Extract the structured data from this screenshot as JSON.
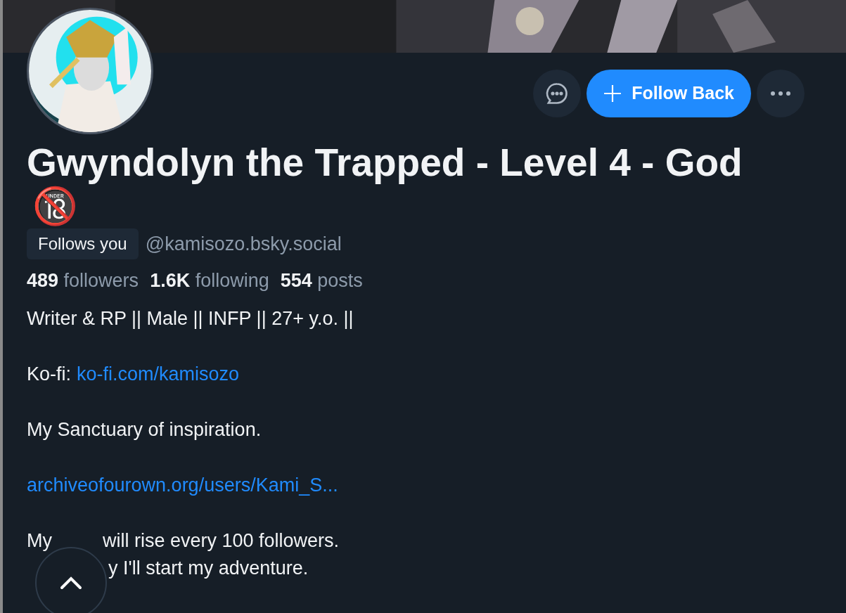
{
  "profile": {
    "display_name": "Gwyndolyn the Trapped - Level 4 - God",
    "badge_icon": "🔞",
    "follows_you": "Follows you",
    "handle": "@kamisozo.bsky.social"
  },
  "actions": {
    "follow_button": "Follow Back"
  },
  "stats": [
    {
      "count": "489",
      "label": "followers"
    },
    {
      "count": "1.6K",
      "label": "following"
    },
    {
      "count": "554",
      "label": "posts"
    }
  ],
  "bio": [
    {
      "kind": "text",
      "text": "Writer & RP || Male || INFP || 27+ y.o. ||"
    },
    {
      "kind": "labeled_link",
      "label": "Ko-fi:",
      "link": "ko-fi.com/kamisozo"
    },
    {
      "kind": "text",
      "text": "My Sanctuary of inspiration."
    },
    {
      "kind": "link",
      "link": "archiveofourown.org/users/Kami_S..."
    },
    {
      "kind": "split",
      "before": "My",
      "after": "will rise every 100 followers."
    },
    {
      "kind": "covered",
      "text": "y I'll start my adventure."
    }
  ]
}
